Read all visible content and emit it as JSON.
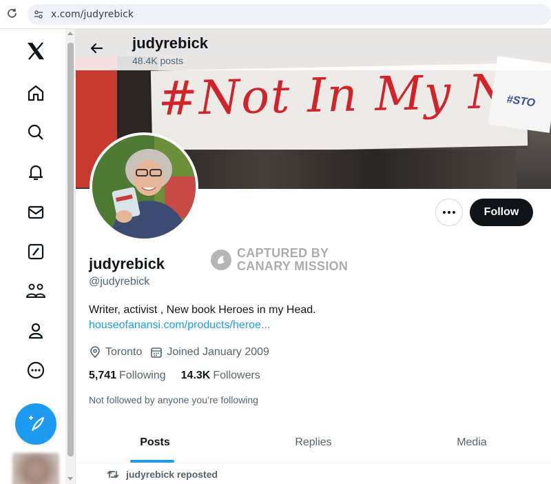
{
  "browser": {
    "url": "x.com/judyrebick"
  },
  "sidebar": {
    "items": [
      {
        "name": "x-logo-icon"
      },
      {
        "name": "home-icon"
      },
      {
        "name": "search-icon"
      },
      {
        "name": "notifications-icon"
      },
      {
        "name": "messages-icon"
      },
      {
        "name": "grok-icon"
      },
      {
        "name": "communities-icon"
      },
      {
        "name": "profile-icon"
      },
      {
        "name": "more-icon"
      }
    ],
    "compose_icon": "feather-plus-icon"
  },
  "header": {
    "name": "judyrebick",
    "posts_count": "48.4K posts"
  },
  "banner": {
    "sign_text": "#Not In My Name",
    "side_sign_text": "#STO"
  },
  "profile": {
    "display_name": "judyrebick",
    "handle": "@judyrebick",
    "bio": "Writer, activist , New book Heroes in my Head.",
    "link": "houseofanansi.com/products/heroe...",
    "location": "Toronto",
    "joined": "Joined January 2009",
    "following_count": "5,741",
    "following_label": "Following",
    "followers_count": "14.3K",
    "followers_label": "Followers",
    "not_followed_note": "Not followed by anyone you’re following"
  },
  "actions": {
    "follow_label": "Follow"
  },
  "watermark": {
    "line1": "CAPTURED BY",
    "line2": "CANARY MISSION"
  },
  "tabs": [
    {
      "label": "Posts",
      "active": true
    },
    {
      "label": "Replies",
      "active": false
    },
    {
      "label": "Media",
      "active": false
    }
  ],
  "feed": {
    "repost_text": "judyrebick reposted"
  },
  "colors": {
    "accent": "#1d9bf0",
    "text_primary": "#0f1419",
    "text_secondary": "#536471",
    "follow_button": "#0f1419"
  }
}
